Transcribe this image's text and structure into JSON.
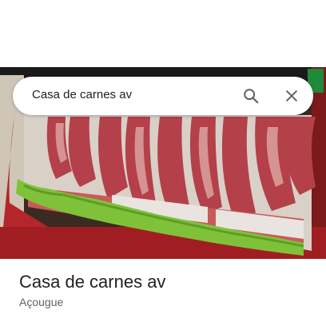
{
  "search": {
    "query": "Casa de carnes av"
  },
  "icons": {
    "search": "search-icon",
    "close": "close-icon"
  },
  "place": {
    "name": "Casa de carnes av",
    "category": "Açougue"
  },
  "colors": {
    "text_primary": "#202124",
    "text_secondary": "#5f6368",
    "icon": "#5f6368"
  }
}
